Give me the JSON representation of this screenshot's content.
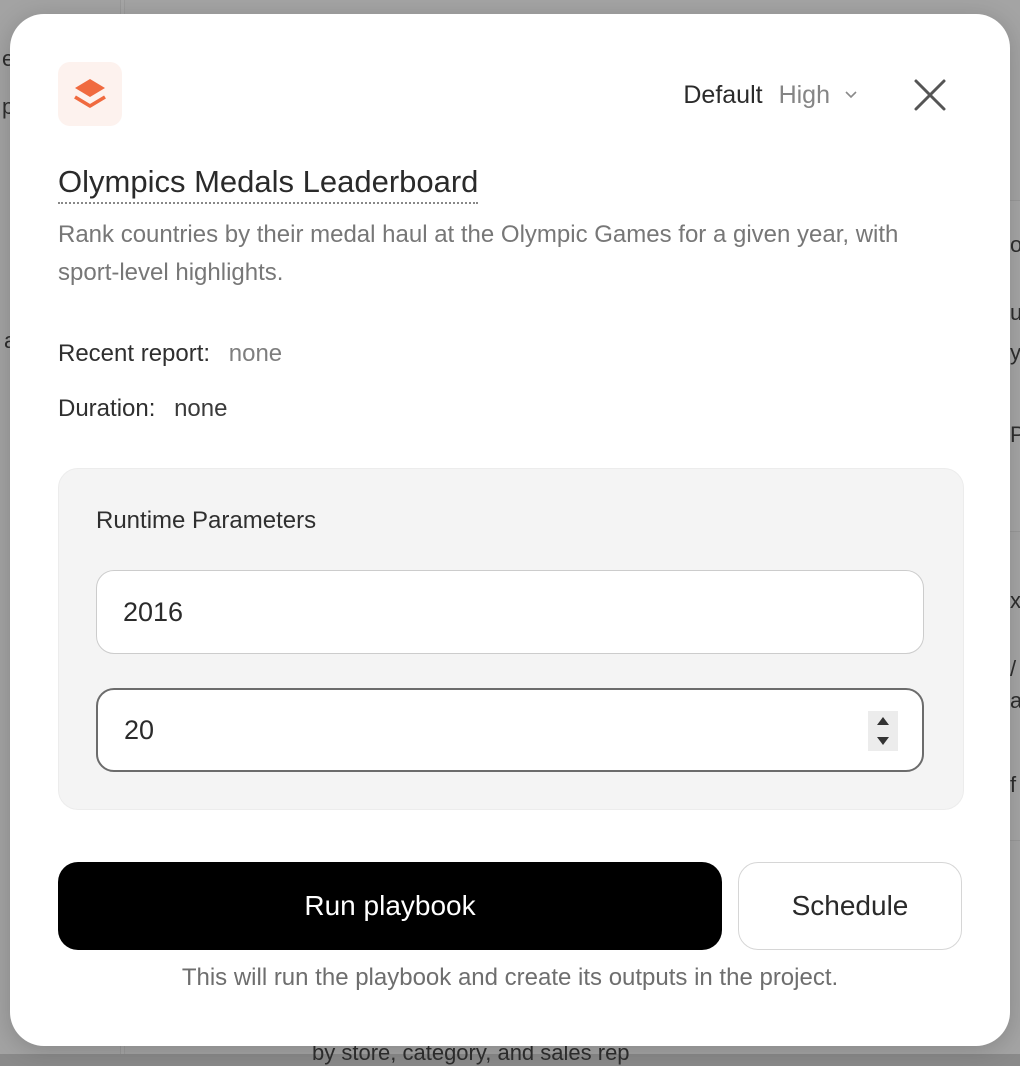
{
  "background": {
    "left_fragments": [
      "e",
      "p",
      "a"
    ],
    "right_fragments": [
      "o",
      "u",
      "y",
      "P",
      "x",
      "/",
      "a",
      "f"
    ],
    "bottom_text": "by store, category, and sales rep"
  },
  "header": {
    "priority_label": "Default",
    "priority_value": "High",
    "logo_icon": "stack-layers-icon",
    "accent_color": "#f06a3f"
  },
  "playbook": {
    "title": "Olympics Medals Leaderboard",
    "description": "Rank countries by their medal haul at the Olympic Games for a given year, with sport-level highlights."
  },
  "meta": {
    "recent_report_label": "Recent report:",
    "recent_report_value": "none",
    "duration_label": "Duration:",
    "duration_value": "none"
  },
  "params": {
    "title": "Runtime Parameters",
    "year_value": "2016",
    "count_value": "20"
  },
  "actions": {
    "run_label": "Run playbook",
    "schedule_label": "Schedule",
    "footnote": "This will run the playbook and create its outputs in the project."
  }
}
